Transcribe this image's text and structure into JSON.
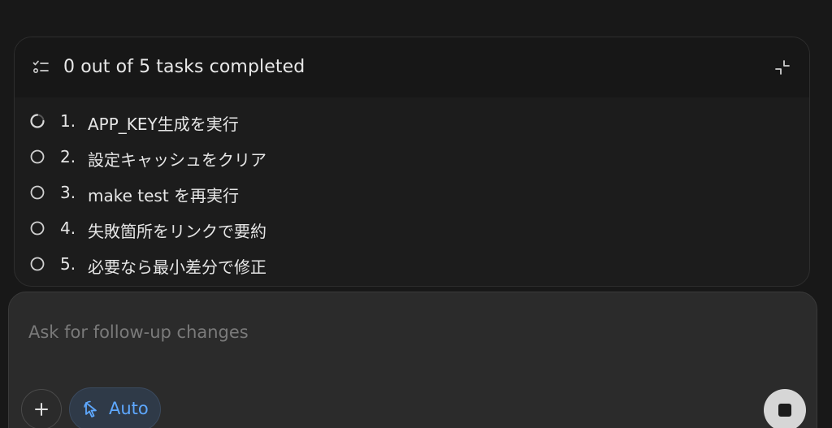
{
  "task_panel": {
    "title": "0 out of 5 tasks completed",
    "header_icon": "list-checks-icon",
    "collapse_icon": "collapse-icon",
    "tasks": [
      {
        "number": "1.",
        "text": "APP_KEY生成を実行",
        "status": "in-progress"
      },
      {
        "number": "2.",
        "text": "設定キャッシュをクリア",
        "status": "pending"
      },
      {
        "number": "3.",
        "text": "make test を再実行",
        "status": "pending"
      },
      {
        "number": "4.",
        "text": "失敗箇所をリンクで要約",
        "status": "pending"
      },
      {
        "number": "5.",
        "text": "必要なら最小差分で修正",
        "status": "pending"
      }
    ]
  },
  "composer": {
    "placeholder": "Ask for follow-up changes",
    "value": "",
    "add_icon": "plus-icon",
    "mode_icon": "cursor-pointer-icon",
    "mode_label": "Auto",
    "stop_icon": "stop-icon",
    "accent_color": "#5ea8ff"
  }
}
